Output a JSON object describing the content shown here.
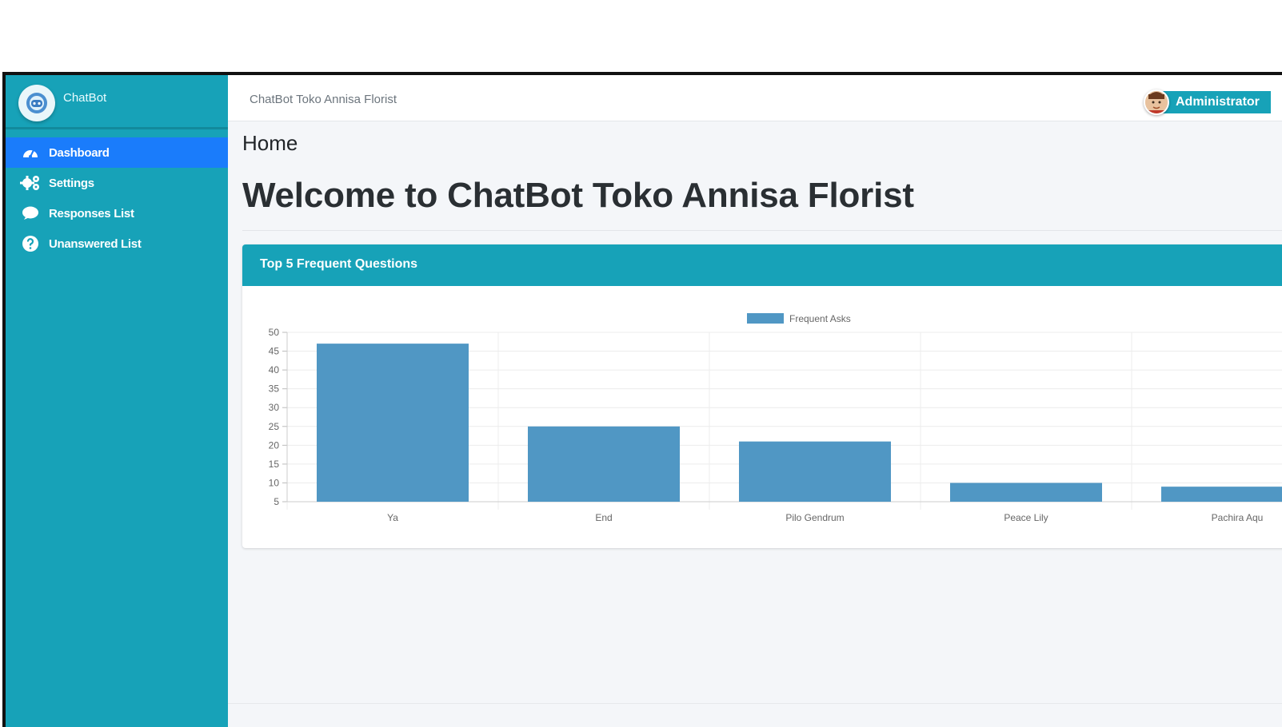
{
  "brand": {
    "name": "ChatBot"
  },
  "sidebar": {
    "items": [
      {
        "label": "Dashboard",
        "icon": "dashboard-icon",
        "active": true
      },
      {
        "label": "Settings",
        "icon": "gears-icon",
        "active": false
      },
      {
        "label": "Responses List",
        "icon": "comment-icon",
        "active": false
      },
      {
        "label": "Unanswered List",
        "icon": "question-circle-icon",
        "active": false
      }
    ]
  },
  "topbar": {
    "title": "ChatBot Toko Annisa Florist",
    "user": "Administrator"
  },
  "breadcrumb": {
    "home": "Home"
  },
  "page": {
    "title": "Welcome to ChatBot Toko Annisa Florist"
  },
  "card": {
    "title": "Top 5 Frequent Questions"
  },
  "colors": {
    "accent": "#17a2b8",
    "active": "#1a7cfb",
    "bar": "#5097c4"
  },
  "chart_data": {
    "type": "bar",
    "categories": [
      "Ya",
      "End",
      "Pilo Gendrum",
      "Peace Lily",
      "Pachira Aqu"
    ],
    "series": [
      {
        "name": "Frequent Asks",
        "values": [
          47,
          25,
          21,
          10,
          9
        ]
      }
    ],
    "ylim": [
      5,
      50
    ],
    "yticks": [
      5,
      10,
      15,
      20,
      25,
      30,
      35,
      40,
      45,
      50
    ],
    "grid": true,
    "legend": "top-center"
  }
}
